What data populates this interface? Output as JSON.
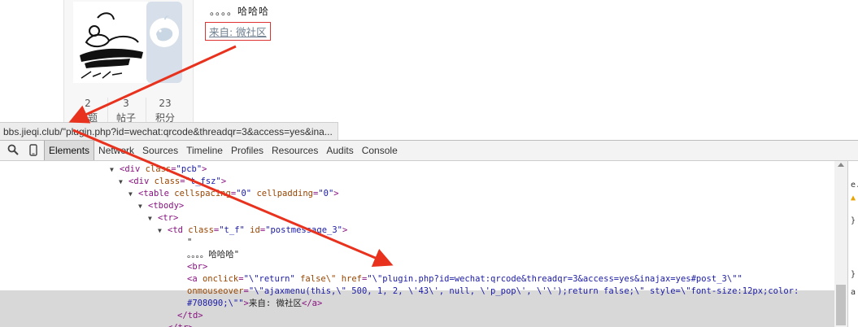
{
  "profile": {
    "stats": [
      {
        "value": "2",
        "label": "主题"
      },
      {
        "value": "3",
        "label": "帖子"
      },
      {
        "value": "23",
        "label": "积分"
      }
    ]
  },
  "post": {
    "text": "。。。。哈哈哈",
    "from_link": "来自: 微社区"
  },
  "status_url": "bbs.jieqi.club/\"plugin.php?id=wechat:qrcode&threadqr=3&access=yes&ina...",
  "devtools": {
    "tabs": [
      "Elements",
      "Network",
      "Sources",
      "Timeline",
      "Profiles",
      "Resources",
      "Audits",
      "Console"
    ],
    "active_tab": "Elements",
    "lines": [
      {
        "indent": 147,
        "tri": "▼",
        "parts": [
          [
            "tag",
            "<div "
          ],
          [
            "attr",
            "class"
          ],
          [
            "tag",
            "="
          ],
          [
            "val",
            "\"pcb\""
          ],
          [
            "tag",
            ">"
          ]
        ]
      },
      {
        "indent": 158,
        "tri": "▼",
        "parts": [
          [
            "tag",
            "<div "
          ],
          [
            "attr",
            "class"
          ],
          [
            "tag",
            "="
          ],
          [
            "val",
            "\"t_fsz\""
          ],
          [
            "tag",
            ">"
          ]
        ]
      },
      {
        "indent": 170,
        "tri": "▼",
        "parts": [
          [
            "tag",
            "<table "
          ],
          [
            "attr",
            "cellspacing"
          ],
          [
            "tag",
            "="
          ],
          [
            "val",
            "\"0\""
          ],
          [
            "tag",
            " "
          ],
          [
            "attr",
            "cellpadding"
          ],
          [
            "tag",
            "="
          ],
          [
            "val",
            "\"0\""
          ],
          [
            "tag",
            ">"
          ]
        ]
      },
      {
        "indent": 182,
        "tri": "▼",
        "parts": [
          [
            "tag",
            "<tbody>"
          ]
        ]
      },
      {
        "indent": 194,
        "tri": "▼",
        "parts": [
          [
            "tag",
            "<tr>"
          ]
        ]
      },
      {
        "indent": 206,
        "tri": "▼",
        "parts": [
          [
            "tag",
            "<td "
          ],
          [
            "attr",
            "class"
          ],
          [
            "tag",
            "="
          ],
          [
            "val",
            "\"t_f\""
          ],
          [
            "tag",
            " "
          ],
          [
            "attr",
            "id"
          ],
          [
            "tag",
            "="
          ],
          [
            "val",
            "\"postmessage_3\""
          ],
          [
            "tag",
            ">"
          ]
        ]
      },
      {
        "indent": 230,
        "tri": "",
        "parts": [
          [
            "txt",
            "\""
          ]
        ]
      },
      {
        "indent": 230,
        "tri": "",
        "parts": [
          [
            "txt",
            "。。。。哈哈哈\""
          ]
        ]
      },
      {
        "indent": 230,
        "tri": "",
        "parts": [
          [
            "tag",
            "<br>"
          ]
        ]
      },
      {
        "indent": 230,
        "tri": "",
        "parts": [
          [
            "tag",
            "<a "
          ],
          [
            "attr",
            "onclick"
          ],
          [
            "tag",
            "="
          ],
          [
            "val",
            "\"\\\"return\""
          ],
          [
            "tag",
            " "
          ],
          [
            "attr",
            "false\\\""
          ],
          [
            "tag",
            " "
          ],
          [
            "attr",
            "href"
          ],
          [
            "tag",
            "="
          ],
          [
            "val",
            "\"\\\"plugin.php?id=wechat:qrcode&threadqr=3&access=yes&inajax=yes#post_3\\\"\""
          ]
        ]
      },
      {
        "indent": 230,
        "tri": "",
        "parts": [
          [
            "attr",
            "onmouseover"
          ],
          [
            "tag",
            "="
          ],
          [
            "val",
            "\"\\\"ajaxmenu(this,\\\" 500, 1, 2, \\'43\\', null, \\'p_pop\\', \\'\\');return false;\\\" style=\\\"font-size:12px;color:"
          ]
        ]
      },
      {
        "indent": 230,
        "tri": "",
        "parts": [
          [
            "val",
            "#708090;\\\"\""
          ],
          [
            "tag",
            ">"
          ],
          [
            "txt",
            "来自: 微社区"
          ],
          [
            "tag",
            "</a>"
          ]
        ]
      },
      {
        "indent": 218,
        "tri": "",
        "parts": [
          [
            "tag",
            "</td>"
          ]
        ]
      },
      {
        "indent": 206,
        "tri": "",
        "parts": [
          [
            "tag",
            "</tr>"
          ]
        ]
      }
    ]
  },
  "styles_pane": [
    "e.",
    "}",
    "}",
    "a"
  ],
  "colors": {
    "link": "#708090",
    "annotation": "#e8321e"
  }
}
